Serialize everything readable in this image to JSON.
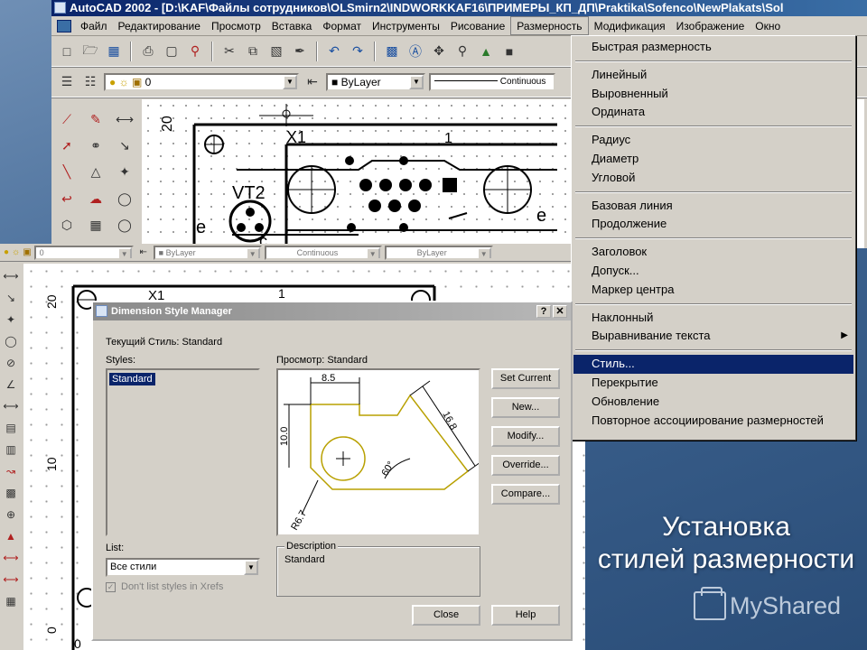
{
  "acad": {
    "title": "AutoCAD 2002 - [D:\\KAF\\Файлы сотрудников\\OLSmirn2\\INDWORKKAF16\\ПРИМЕРЫ_КП_ДП\\Praktika\\Sofenco\\NewPlakats\\Sol",
    "menu": [
      "Файл",
      "Редактирование",
      "Просмотр",
      "Вставка",
      "Формат",
      "Инструменты",
      "Рисование",
      "Размерность",
      "Модификация",
      "Изображение",
      "Окно"
    ],
    "layer_value": "0",
    "color_value": "ByLayer",
    "linetype_value": "Continuous",
    "drawing_labels": {
      "x1": "X1",
      "one": "1",
      "vt2": "VT2",
      "e": "e",
      "c": "c",
      "e2": "e",
      "twenty": "20"
    }
  },
  "acad2": {
    "layer_value": "0",
    "color_value": "ByLayer",
    "linetype_value": "Continuous",
    "lineweight_value": "ByLayer",
    "drawing_labels": {
      "x1": "X1",
      "one": "1",
      "twenty": "20",
      "ten": "10",
      "zero": "0",
      "zero_bottom": "0"
    }
  },
  "dim_menu": {
    "groups": [
      [
        "Быстрая размерность"
      ],
      [
        "Линейный",
        "Выровненный",
        "Ордината"
      ],
      [
        "Радиус",
        "Диаметр",
        "Угловой"
      ],
      [
        "Базовая линия",
        "Продолжение"
      ],
      [
        "Заголовок",
        "Допуск...",
        "Маркер центра"
      ],
      [
        "Наклонный",
        "Выравнивание текста"
      ],
      [
        "Стиль...",
        "Перекрытие",
        "Обновление",
        "Повторное ассоциирование размерностей"
      ]
    ],
    "selected": "Стиль...",
    "submenu_item": "Выравнивание текста"
  },
  "dialog": {
    "title": "Dimension Style Manager",
    "current_style_label": "Текущий Стиль: Standard",
    "styles_label": "Styles:",
    "styles": [
      "Standard"
    ],
    "preview_label": "Просмотр: Standard",
    "buttons": {
      "set_current": "Set Current",
      "new": "New...",
      "modify": "Modify...",
      "override": "Override...",
      "compare": "Compare...",
      "close": "Close",
      "help": "Help"
    },
    "list_label": "List:",
    "list_value": "Все стили",
    "xrefs_checkbox": "Don't list styles in Xrefs",
    "description_label": "Description",
    "description_value": "Standard",
    "preview_dims": {
      "top": "8.5",
      "left": "10.0",
      "diag": "16.8",
      "angle": "60°",
      "radius": "R6.7"
    }
  },
  "slide": {
    "caption_line1": "Установка",
    "caption_line2": "стилей размерности",
    "watermark": "MyShared"
  },
  "colors": {
    "selection": "#0a246a",
    "title_active": "#0a246a",
    "preview_outline": "#b8a000"
  }
}
